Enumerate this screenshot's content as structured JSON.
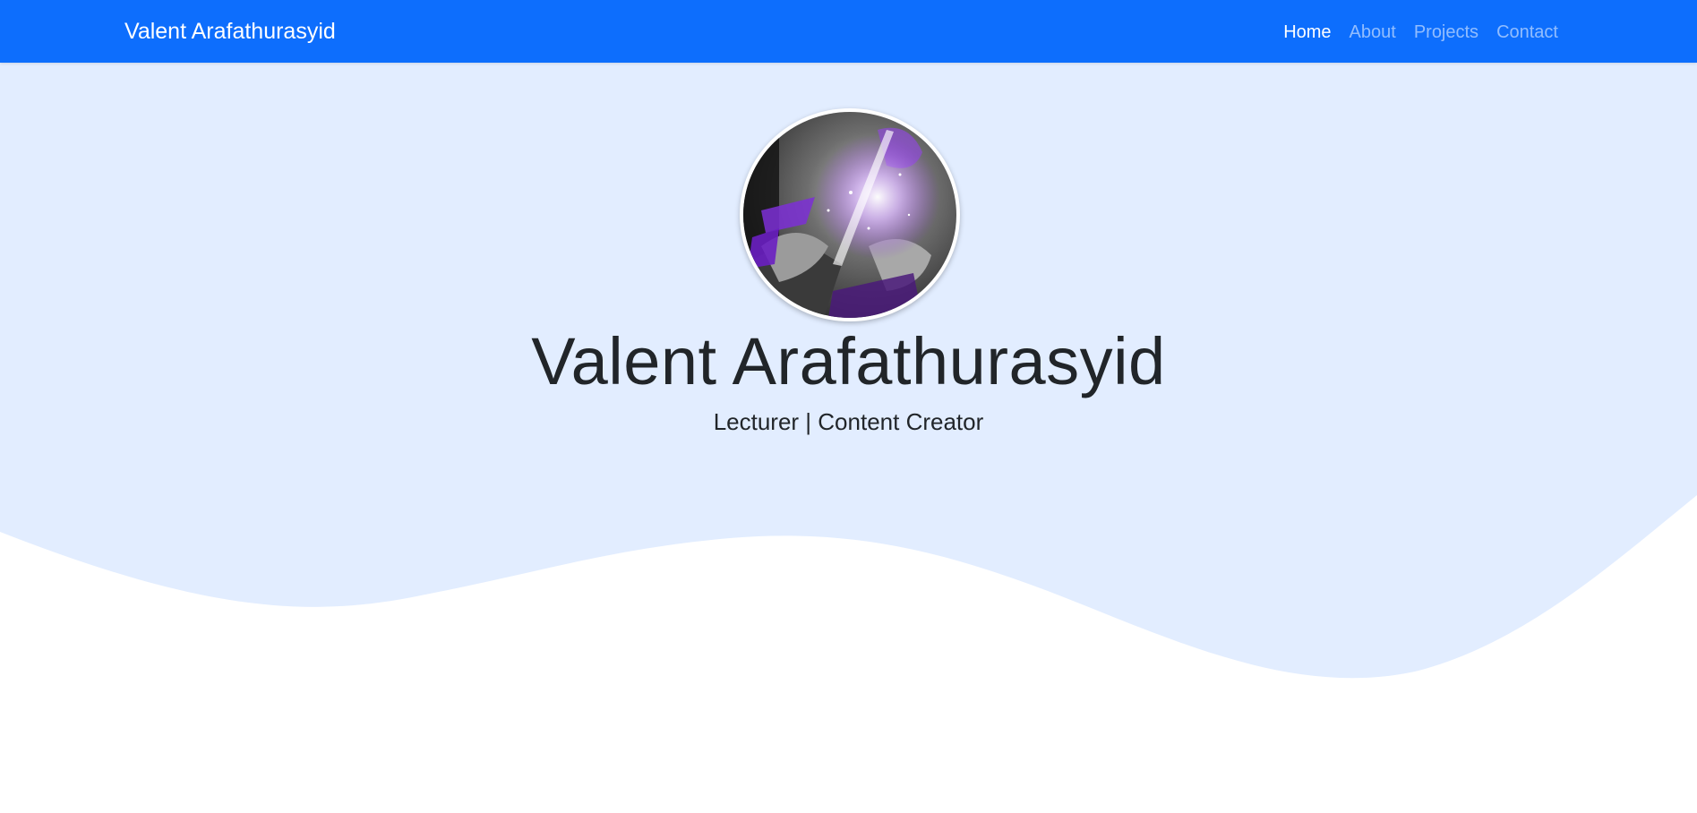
{
  "navbar": {
    "brand": "Valent Arafathurasyid",
    "links": [
      {
        "label": "Home",
        "active": true
      },
      {
        "label": "About",
        "active": false
      },
      {
        "label": "Projects",
        "active": false
      },
      {
        "label": "Contact",
        "active": false
      }
    ]
  },
  "hero": {
    "name": "Valent Arafathurasyid",
    "tagline": "Lecturer | Content Creator",
    "avatar_icon": "profile-photo"
  },
  "colors": {
    "navbar_bg": "#0d6efd",
    "hero_bg": "#e2edff",
    "text": "#212529",
    "nav_active": "#ffffff",
    "nav_inactive": "rgba(255,255,255,0.55)"
  }
}
